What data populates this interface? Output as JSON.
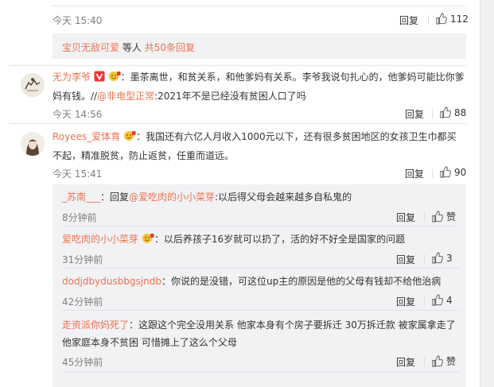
{
  "top_comment": {
    "time": "今天 15:40",
    "reply_label": "回复",
    "like_count": "112",
    "more": {
      "users": "宝贝无敌可爱",
      "middle": "等人",
      "count_link": "共50条回复"
    }
  },
  "comment1": {
    "user": "无为李爷",
    "text_lines": [
      "：墨茶离世，和贫关系，和他爹妈有关系。李爷我说句扎心的，他爹妈可能比你爹",
      "妈有钱。//"
    ],
    "mention": "@非电型正常",
    "mention_text": ":2021年不是已经没有贫困人口了吗",
    "time": "今天 14:56",
    "reply_label": "回复",
    "like_count": "88"
  },
  "comment2": {
    "user": "Royees_爱体育",
    "text_lines": [
      "：我国还有六亿人月收入1000元以下，还有很多贫困地区的女孩卫生巾都买",
      "不起，精准脱贫，防止返贫，任重而道远。"
    ],
    "time": "今天 15:41",
    "reply_label": "回复",
    "like_count": "90",
    "replies": [
      {
        "user": "_苏南___",
        "pre": "：回复",
        "mention": "@爱吃肉的小小菜芽",
        "text": ":以后得父母会越来越多自私鬼的",
        "time": "8分钟前",
        "reply_label": "回复",
        "like_label": "赞"
      },
      {
        "user": "爱吃肉的小小菜芽",
        "text": "：以后养孩子16岁就可以扔了，活的好不好全是国家的问题",
        "time": "31分钟前",
        "reply_label": "回复",
        "like_label": "3"
      },
      {
        "user": "dodjdbydusbbgsjndb",
        "text": "：你说的是没错，可这位up主的原因是他的父母有钱却不给他治病",
        "time": "42分钟前",
        "reply_label": "回复",
        "like_label": "4"
      },
      {
        "user": "走资派你妈死了",
        "text_lines": [
          "：这跟这个完全没用关系 他家本身有个房子要拆迁 30万拆迁款 被家属拿走了",
          "他家庭本身不贫困 可惜摊上了这么个父母"
        ],
        "time": "45分钟前",
        "reply_label": "回复",
        "like_label": "赞"
      }
    ]
  },
  "colors": {
    "accent": "#eb7350",
    "muted": "#808080",
    "sub_bg": "#f2f2f5"
  }
}
